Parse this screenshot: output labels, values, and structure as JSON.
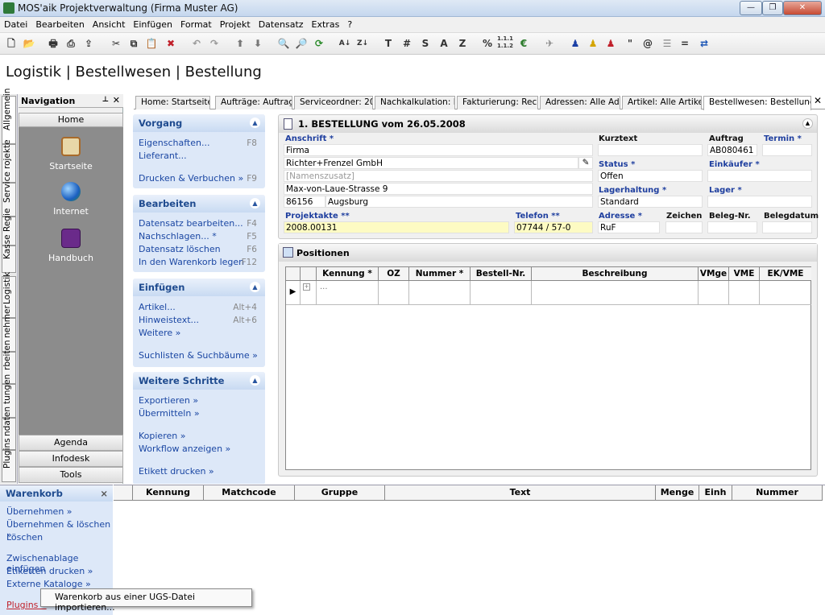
{
  "window": {
    "title": "MOS'aik Projektverwaltung (Firma Muster AG)",
    "min": "—",
    "max": "❐",
    "close": "✕"
  },
  "menu": [
    "Datei",
    "Bearbeiten",
    "Ansicht",
    "Einfügen",
    "Format",
    "Projekt",
    "Datensatz",
    "Extras",
    "?"
  ],
  "toolbar": {
    "t1": "T",
    "t2": "#",
    "t3": "S",
    "t4": "A",
    "t5": "Z",
    "t6": "%",
    "t7": "€",
    "t8": "\"",
    "t9": "@",
    "t10": "="
  },
  "breadcrumb": "Logistik | Bestellwesen | Bestellung",
  "nav": {
    "title": "Navigation",
    "pin": "📌",
    "close": "✕",
    "home": "Home",
    "icons": [
      "Startseite",
      "Internet",
      "Handbuch"
    ],
    "bottom": [
      "Agenda",
      "Infodesk",
      "Tools"
    ],
    "vtabs": [
      "Allgemein",
      "rojekte",
      "Service",
      "Regie",
      "Kasse",
      "Logistik",
      "nehmer",
      "rbeiten",
      "tungen",
      "ndaten",
      "Plugins"
    ]
  },
  "tasks": {
    "vorgang": {
      "title": "Vorgang",
      "items": [
        {
          "label": "Eigenschaften...",
          "sc": "F8"
        },
        {
          "label": "Lieferant...",
          "sc": ""
        },
        {
          "label": "Drucken & Verbuchen »",
          "sc": "F9"
        }
      ]
    },
    "bearbeiten": {
      "title": "Bearbeiten",
      "items": [
        {
          "label": "Datensatz bearbeiten...",
          "sc": "F4"
        },
        {
          "label": "Nachschlagen... *",
          "sc": "F5"
        },
        {
          "label": "Datensatz löschen",
          "sc": "F6"
        },
        {
          "label": "In den Warenkorb legen",
          "sc": "F12"
        }
      ]
    },
    "einfuegen": {
      "title": "Einfügen",
      "items": [
        {
          "label": "Artikel...",
          "sc": "Alt+4"
        },
        {
          "label": "Hinweistext...",
          "sc": "Alt+6"
        },
        {
          "label": "Weitere »",
          "sc": ""
        },
        {
          "label": "Suchlisten & Suchbäume »",
          "sc": ""
        }
      ]
    },
    "weitere": {
      "title": "Weitere Schritte",
      "items": [
        {
          "label": "Exportieren »",
          "sc": ""
        },
        {
          "label": "Übermitteln »",
          "sc": ""
        },
        {
          "label": "Kopieren »",
          "sc": ""
        },
        {
          "label": "Workflow anzeigen »",
          "sc": ""
        },
        {
          "label": "Etikett drucken »",
          "sc": ""
        }
      ]
    }
  },
  "tabs": [
    "Home: Startseite",
    "Aufträge: Auftrag",
    "Serviceordner: 20€",
    "Nachkalkulation: Bu",
    "Fakturierung: Rech",
    "Adressen: Alle Adr",
    "Artikel: Alle Artikel",
    "Bestellwesen: Bestellung"
  ],
  "form": {
    "heading": "1. BESTELLUNG vom 26.05.2008",
    "anschrift_label": "Anschrift *",
    "anschrift_1": "Firma",
    "anschrift_2": "Richter+Frenzel GmbH",
    "anschrift_3": "[Namenszusatz]",
    "anschrift_4": "Max-von-Laue-Strasse 9",
    "plz": "86156",
    "ort": "Augsburg",
    "projektakte_label": "Projektakte **",
    "projektakte": "2008.00131",
    "telefon_label": "Telefon **",
    "telefon": "07744 / 57-0",
    "kurztext_label": "Kurztext",
    "kurztext": "",
    "status_label": "Status *",
    "status": "Offen",
    "lagerhaltung_label": "Lagerhaltung *",
    "lagerhaltung": "Standard",
    "adresse_label": "Adresse *",
    "adresse": "RuF",
    "zeichen_label": "Zeichen",
    "auftrag_label": "Auftrag",
    "auftrag": "AB080461",
    "termin_label": "Termin *",
    "einkaeufer_label": "Einkäufer *",
    "lager_label": "Lager *",
    "belegnr_label": "Beleg-Nr.",
    "belegdatum_label": "Belegdatum"
  },
  "positions": {
    "title": "Positionen",
    "columns": [
      "Kennung *",
      "OZ",
      "Nummer *",
      "Bestell-Nr.",
      "Beschreibung",
      "VMge",
      "VME",
      "EK/VME"
    ],
    "row_placeholder": "..."
  },
  "basket": {
    "title": "Warenkorb",
    "close": "×",
    "items": [
      "Übernehmen »",
      "Übernehmen & löschen »",
      "Löschen",
      "Zwischenablage einfügen",
      "Etiketten drucken »",
      "Externe Kataloge »",
      "Plugins »"
    ],
    "columns": [
      "Kennung",
      "Matchcode",
      "Gruppe",
      "Text",
      "Menge",
      "Einh",
      "Nummer"
    ]
  },
  "popup": "Warenkorb aus einer UGS-Datei importieren..."
}
